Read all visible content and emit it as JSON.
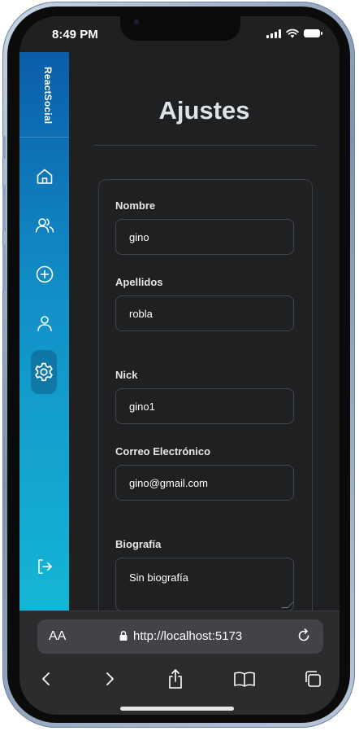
{
  "status_bar": {
    "time": "8:49 PM"
  },
  "sidebar": {
    "brand": "ReactSocial",
    "items": [
      {
        "name": "home",
        "icon": "home-icon"
      },
      {
        "name": "people",
        "icon": "users-icon"
      },
      {
        "name": "create",
        "icon": "plus-circle-icon"
      },
      {
        "name": "profile",
        "icon": "user-icon"
      },
      {
        "name": "settings",
        "icon": "gear-icon",
        "active": true
      },
      {
        "name": "logout",
        "icon": "logout-icon"
      }
    ]
  },
  "page": {
    "title": "Ajustes",
    "form": {
      "nombre": {
        "label": "Nombre",
        "value": "gino"
      },
      "apellidos": {
        "label": "Apellidos",
        "value": "robla"
      },
      "nick": {
        "label": "Nick",
        "value": "gino1"
      },
      "email": {
        "label": "Correo Electrónico",
        "value": "gino@gmail.com"
      },
      "bio": {
        "label": "Biografía",
        "value": "Sin biografía"
      }
    }
  },
  "browser": {
    "aa_label": "AA",
    "url": "http://localhost:5173",
    "toolbar": [
      "back",
      "forward",
      "share",
      "bookmarks",
      "tabs"
    ]
  },
  "colors": {
    "sidebar_top": "#0b5ea8",
    "sidebar_bottom": "#15b6d5",
    "background": "#1f2021",
    "field_border": "#41454b"
  }
}
